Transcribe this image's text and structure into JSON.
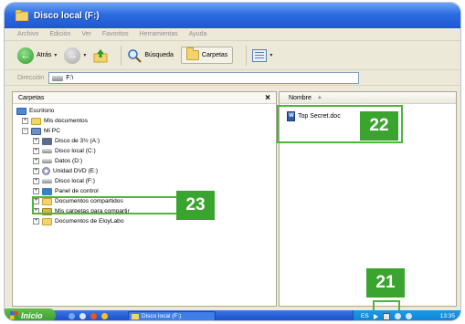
{
  "window": {
    "title": "Disco local (F:)"
  },
  "menu": [
    "Archivo",
    "Edición",
    "Ver",
    "Favoritos",
    "Herramientas",
    "Ayuda"
  ],
  "toolbar": {
    "back_label": "Atrás",
    "search_label": "Búsqueda",
    "folders_label": "Carpetas"
  },
  "address": {
    "label": "Dirección",
    "value": "F:\\"
  },
  "folders_pane": {
    "title": "Carpetas",
    "close": "×",
    "tree": [
      "Escritorio",
      "Mis documentos",
      "Mi PC",
      "Disco de 3½ (A:)",
      "Disco local (C:)",
      "Datos (D:)",
      "Unidad DVD (E:)",
      "Disco local (F:)",
      "Panel de control",
      "Documentos compartidos",
      "Mis carpetas para compartir",
      "Documentos de EloyLabo"
    ],
    "expanders": [
      "+",
      "−",
      "+",
      "+",
      "+",
      "+",
      "+",
      "+",
      "+",
      "+",
      "+"
    ]
  },
  "files_pane": {
    "column_name": "Nombre",
    "sort_glyph": "▲",
    "files": [
      "Top Secret.doc"
    ]
  },
  "callouts": {
    "file": "22",
    "tree": "23",
    "tray": "21"
  },
  "taskbar": {
    "start_label": "Inicio",
    "task_label": "Disco local (F:)",
    "lang": "ES",
    "clock": "13:35"
  },
  "colors": {
    "callout_green": "#3aa52e",
    "title_blue": "#2c6ce0",
    "chrome": "#ece9d8"
  }
}
